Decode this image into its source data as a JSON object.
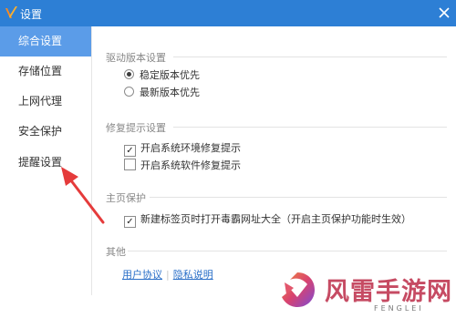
{
  "titlebar": {
    "title": "设置",
    "logo_icon": "v-logo-icon",
    "close_icon": "close-icon"
  },
  "sidebar": {
    "items": [
      {
        "label": "综合设置",
        "active": true
      },
      {
        "label": "存储位置",
        "active": false
      },
      {
        "label": "上网代理",
        "active": false
      },
      {
        "label": "安全保护",
        "active": false
      },
      {
        "label": "提醒设置",
        "active": false
      }
    ]
  },
  "sections": {
    "driver": {
      "title": "驱动版本设置",
      "options": [
        {
          "label": "稳定版本优先",
          "checked": true
        },
        {
          "label": "最新版本优先",
          "checked": false
        }
      ]
    },
    "repair": {
      "title": "修复提示设置",
      "options": [
        {
          "label": "开启系统环境修复提示",
          "checked": true
        },
        {
          "label": "开启系统软件修复提示",
          "checked": false
        }
      ]
    },
    "homepage": {
      "title": "主页保护",
      "options": [
        {
          "label": "新建标签页时打开毒霸网址大全（开启主页保护功能时生效）",
          "checked": true
        }
      ]
    },
    "other": {
      "title": "其他",
      "links": {
        "user_agreement": "用户协议",
        "privacy": "隐私说明"
      }
    }
  },
  "watermark": {
    "title": "风雷手游网",
    "subtitle": "FENGLEI"
  },
  "colors": {
    "titlebar": "#2d7fd5",
    "active_nav": "#5b9ce8",
    "arrow": "#e53b3b",
    "link": "#2a6fc8",
    "watermark": "#c64b63"
  }
}
